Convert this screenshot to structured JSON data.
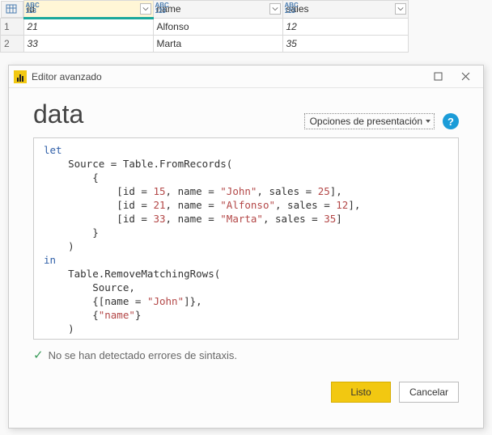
{
  "table": {
    "columns": [
      {
        "name": "id",
        "selected": true
      },
      {
        "name": "name",
        "selected": false
      },
      {
        "name": "sales",
        "selected": false
      }
    ],
    "widths": [
      160,
      160,
      155
    ],
    "rows": [
      {
        "n": "1",
        "id": "21",
        "name": "Alfonso",
        "sales": "12"
      },
      {
        "n": "2",
        "id": "33",
        "name": "Marta",
        "sales": "35"
      }
    ]
  },
  "dialog": {
    "window_title": "Editor avanzado",
    "big_title": "data",
    "display_options": "Opciones de presentación",
    "help": "?",
    "status": "No se han detectado errores de sintaxis.",
    "primary_btn": "Listo",
    "cancel_btn": "Cancelar"
  },
  "code": {
    "l1_kw": "let",
    "l2a": "    Source = Table.FromRecords(",
    "l3": "        {",
    "l4a": "            [id = ",
    "l4n1": "15",
    "l4b": ", name = ",
    "l4s1": "\"John\"",
    "l4c": ", sales = ",
    "l4n2": "25",
    "l4d": "],",
    "l5a": "            [id = ",
    "l5n1": "21",
    "l5b": ", name = ",
    "l5s1": "\"Alfonso\"",
    "l5c": ", sales = ",
    "l5n2": "12",
    "l5d": "],",
    "l6a": "            [id = ",
    "l6n1": "33",
    "l6b": ", name = ",
    "l6s1": "\"Marta\"",
    "l6c": ", sales = ",
    "l6n2": "35",
    "l6d": "]",
    "l7": "        }",
    "l8": "    )",
    "l9_kw": "in",
    "l10": "    Table.RemoveMatchingRows(",
    "l11": "        Source,",
    "l12a": "        {[name = ",
    "l12s": "\"John\"",
    "l12b": "]},",
    "l13a": "        {",
    "l13s": "\"name\"",
    "l13b": "}",
    "l14": "    )"
  }
}
